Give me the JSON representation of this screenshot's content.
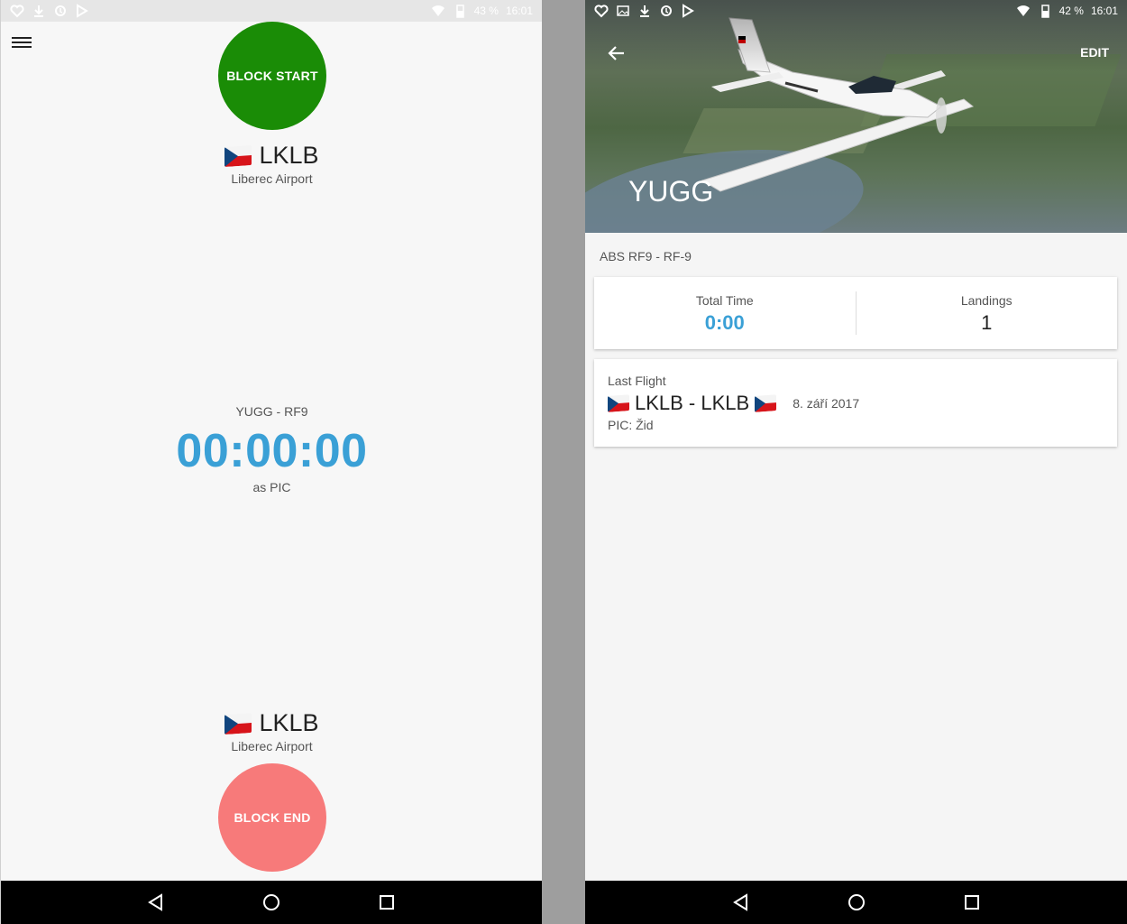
{
  "left_screen": {
    "status_bar": {
      "battery": "43 %",
      "time": "16:01"
    },
    "block_start_label": "BLOCK START",
    "departure": {
      "code": "LKLB",
      "name": "Liberec Airport"
    },
    "timer": {
      "aircraft": "YUGG - RF9",
      "value": "00:00:00",
      "role": "as PIC"
    },
    "arrival": {
      "code": "LKLB",
      "name": "Liberec Airport"
    },
    "block_end_label": "BLOCK END",
    "colors": {
      "block_start": "#1a8c06",
      "block_end": "#f77a7a",
      "timer": "#3aa0d6"
    }
  },
  "right_screen": {
    "status_bar": {
      "battery": "42 %",
      "time": "16:01"
    },
    "header": {
      "title": "YUGG",
      "edit_label": "EDIT"
    },
    "model": "ABS RF9 - RF-9",
    "stats": {
      "total_time_label": "Total Time",
      "total_time_value": "0:00",
      "landings_label": "Landings",
      "landings_value": "1"
    },
    "last_flight": {
      "label": "Last Flight",
      "route": "LKLB - LKLB",
      "date": "8. září 2017",
      "pic": "PIC: Žid"
    }
  },
  "icons": {
    "menu": "hamburger-menu-icon",
    "back": "arrow-back-icon",
    "flag": "czech-flag-icon",
    "nav_back": "triangle-back-icon",
    "nav_home": "circle-home-icon",
    "nav_recent": "square-recent-icon"
  }
}
